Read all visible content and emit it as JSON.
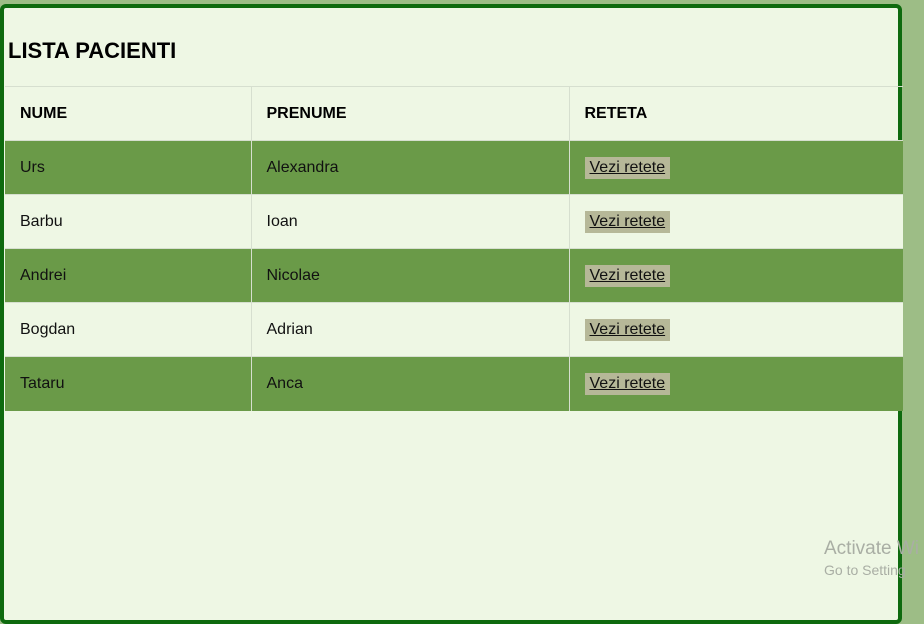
{
  "page": {
    "title": "LISTA PACIENTI"
  },
  "table": {
    "headers": [
      "NUME",
      "PRENUME",
      "RETETA"
    ],
    "rows": [
      {
        "nume": "Urs",
        "prenume": "Alexandra",
        "action": "Vezi retete"
      },
      {
        "nume": "Barbu",
        "prenume": "Ioan",
        "action": "Vezi retete"
      },
      {
        "nume": "Andrei",
        "prenume": "Nicolae",
        "action": "Vezi retete"
      },
      {
        "nume": "Bogdan",
        "prenume": "Adrian",
        "action": "Vezi retete"
      },
      {
        "nume": "Tataru",
        "prenume": "Anca",
        "action": "Vezi retete"
      }
    ]
  },
  "watermark": {
    "title": "Activate Wi",
    "subtitle": "Go to Setting"
  },
  "colors": {
    "border": "#0e6a0e",
    "panel_bg": "#eef7e4",
    "row_dark": "#6a9a48",
    "button_bg": "#b6b898"
  }
}
